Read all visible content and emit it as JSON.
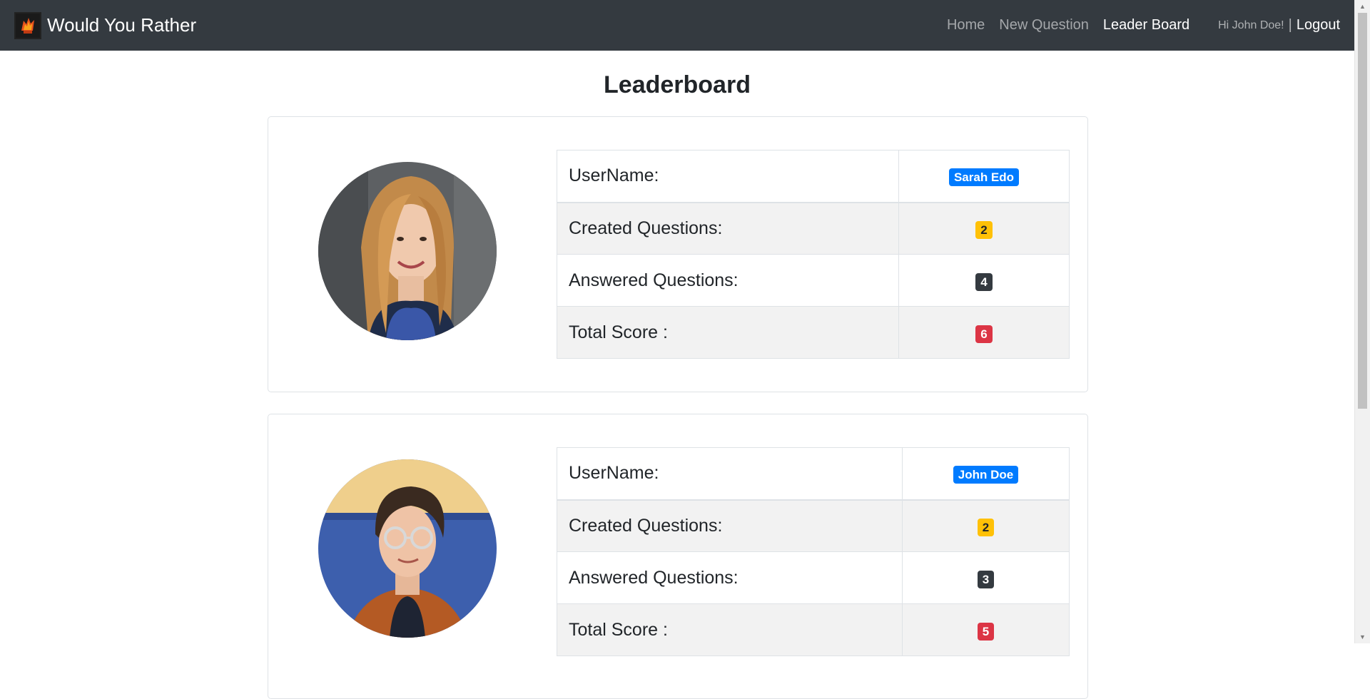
{
  "navbar": {
    "brand": "Would You Rather",
    "links": [
      "Home",
      "New Question",
      "Leader Board"
    ],
    "greeting": "Hi John Doe!",
    "separator": "|",
    "logout": "Logout"
  },
  "page": {
    "title": "Leaderboard"
  },
  "labels": {
    "username": "UserName:",
    "created": "Created Questions:",
    "answered": "Answered Questions:",
    "total": "Total Score :"
  },
  "users": [
    {
      "name": "Sarah Edo",
      "created": "2",
      "answered": "4",
      "total": "6"
    },
    {
      "name": "John Doe",
      "created": "2",
      "answered": "3",
      "total": "5"
    }
  ],
  "colors": {
    "navbar": "#343a40",
    "primary": "#007bff",
    "warning": "#ffc107",
    "dark": "#343a40",
    "danger": "#dc3545"
  }
}
